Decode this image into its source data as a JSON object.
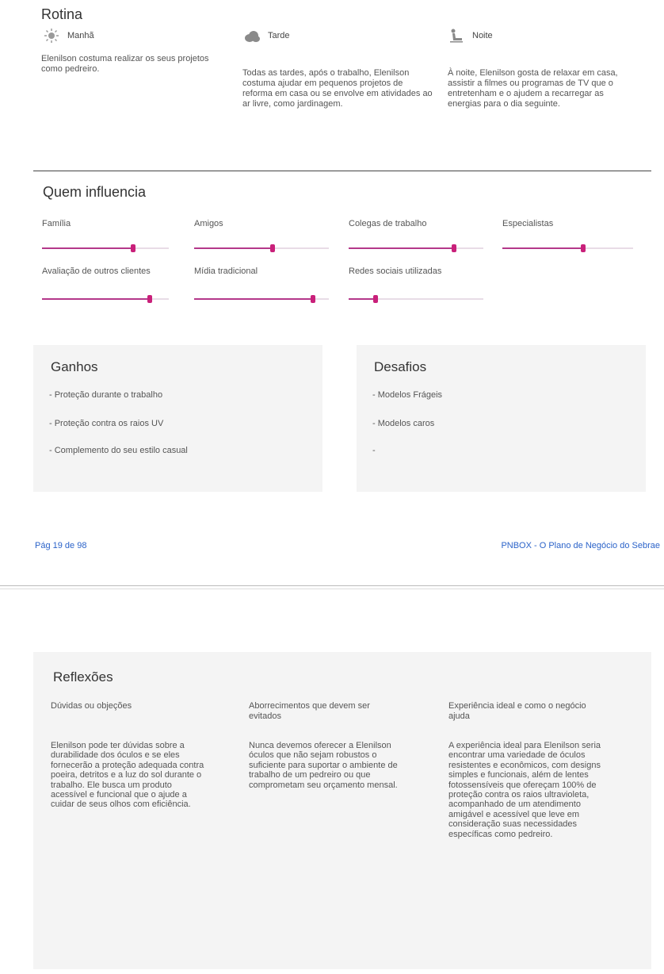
{
  "rotina": {
    "title": "Rotina",
    "periods": [
      {
        "icon": "sun-icon",
        "label": "Manhã",
        "text": "Elenilson costuma realizar os seus projetos como pedreiro."
      },
      {
        "icon": "cloud-icon",
        "label": "Tarde",
        "text": "Todas as tardes, após o trabalho, Elenilson costuma ajudar em pequenos projetos de reforma em casa ou se envolve em atividades ao ar livre, como jardinagem."
      },
      {
        "icon": "person-relaxing-icon",
        "label": "Noite",
        "text": "À noite, Elenilson gosta de relaxar em casa, assistir a filmes ou programas de TV que o entretenham e o ajudem a recarregar as energias para o dia seguinte."
      }
    ]
  },
  "influencia": {
    "title": "Quem influencia",
    "items": [
      {
        "label": "Família",
        "level": 0.72
      },
      {
        "label": "Amigos",
        "level": 0.58
      },
      {
        "label": "Colegas de trabalho",
        "level": 0.78
      },
      {
        "label": "Especialistas",
        "level": 0.62
      },
      {
        "label": "Avaliação de outros clientes",
        "level": 0.85
      },
      {
        "label": "Mídia tradicional",
        "level": 0.88
      },
      {
        "label": "Redes sociais utilizadas",
        "level": 0.2
      }
    ]
  },
  "ganhos": {
    "title": "Ganhos",
    "items": [
      "- Proteção durante o trabalho",
      "- Proteção contra os raios UV",
      "- Complemento do seu estilo casual"
    ]
  },
  "desafios": {
    "title": "Desafios",
    "items": [
      "- Modelos Frágeis",
      "- Modelos caros",
      "-"
    ]
  },
  "footer": {
    "page": "Pág 19 de 98",
    "brand": "PNBOX - O Plano de Negócio do Sebrae"
  },
  "reflexoes": {
    "title": "Reflexões",
    "columns": [
      {
        "title": "Dúvidas ou objeções",
        "text": "Elenilson pode ter dúvidas sobre a durabilidade dos óculos e se eles fornecerão a proteção adequada contra poeira, detritos e a luz do sol durante o trabalho. Ele busca um produto acessível e funcional que o ajude a cuidar de seus olhos com eficiência."
      },
      {
        "title": "Aborrecimentos que devem ser evitados",
        "text": "Nunca devemos oferecer a Elenilson óculos que não sejam robustos o suficiente para suportar o ambiente de trabalho de um pedreiro ou que comprometam seu orçamento mensal."
      },
      {
        "title": "Experiência ideal e como o negócio ajuda",
        "text": "A experiência ideal para Elenilson seria encontrar uma variedade de óculos resistentes e econômicos, com designs simples e funcionais, além de lentes fotossensíveis que ofereçam 100% de proteção contra os raios ultravioleta, acompanhado de um atendimento amigável e acessível que leve em consideração suas necessidades específicas como pedreiro."
      }
    ]
  }
}
